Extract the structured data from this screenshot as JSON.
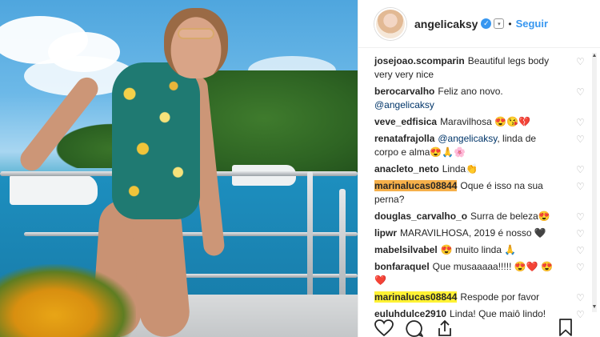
{
  "header": {
    "username": "angelicaksy",
    "separator": "•",
    "follow_label": "Seguir",
    "verified_glyph": "✓",
    "options_glyph": "▾"
  },
  "comments": [
    {
      "user": "josejoao.scomparin",
      "text": "Beautiful legs body very very nice",
      "highlight": ""
    },
    {
      "user": "berocarvalho",
      "text": "Feliz ano novo.",
      "mention": "@angelicaksy",
      "highlight": ""
    },
    {
      "user": "veve_edfisica",
      "text": "Maravilhosa 😍😘💔",
      "highlight": ""
    },
    {
      "user": "renatafrajolla",
      "mention": "@angelicaksy",
      "text": ", linda de corpo e alma😍🙏🌸",
      "highlight": ""
    },
    {
      "user": "anacleto_neto",
      "text": "Linda👏",
      "highlight": ""
    },
    {
      "user": "marinalucas08844",
      "text": "Oque é isso na sua perna?",
      "highlight": "orange"
    },
    {
      "user": "douglas_carvalho_o",
      "text": "Surra de beleza😍",
      "highlight": ""
    },
    {
      "user": "lipwr",
      "text": "MARAVILHOSA, 2019 é nosso 🖤",
      "highlight": ""
    },
    {
      "user": "mabelsilvabel",
      "text": "😍 muito linda 🙏",
      "highlight": ""
    },
    {
      "user": "bonfaraquel",
      "text": "Que musaaaaa!!!!! 😍❤️ 😍❤️",
      "highlight": ""
    },
    {
      "user": "marinalucas08844",
      "text": "Respode por favor",
      "highlight": "yellow"
    },
    {
      "user": "euluhdulce2910",
      "text": "Linda! Que maiô lindo!",
      "highlight": ""
    }
  ],
  "icons": {
    "like": "heart-outline-icon",
    "comment": "comment-bubble-icon",
    "share": "share-icon",
    "save": "bookmark-icon",
    "comment_like": "♡"
  },
  "colors": {
    "accent": "#3897f0",
    "highlight_orange": "#f6b04a",
    "highlight_yellow": "#fff234"
  }
}
